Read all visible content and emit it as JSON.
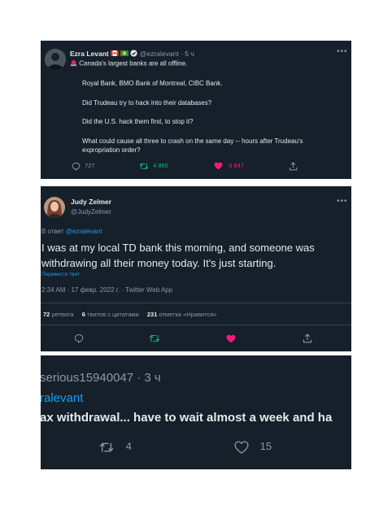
{
  "tweet1": {
    "author_name": "Ezra Levant",
    "handle_time": "@ezralevant · 5 ч",
    "line1": "Canada's largest banks are all offline.",
    "line2": "Royal Bank, BMO Bank of Montreal, CIBC Bank.",
    "line3": "Did Trudeau try to hack into their databases?",
    "line4": "Did the U.S. hack them first, to stop it?",
    "line5a": "What could cause all three to crash on the same day -- hours after Trudeau's",
    "line5b": "expropriation order?",
    "replies": "727",
    "retweets": "4 865",
    "likes": "9 847",
    "colors": {
      "retweet": "#00ba7c",
      "like": "#f91880"
    }
  },
  "tweet2": {
    "author_name": "Judy Zelmer",
    "handle": "@JudyZelmer",
    "reply_prefix": "В ответ",
    "reply_to": "@ezralevant",
    "text_line1": "I was at my local TD bank this morning, and someone was",
    "text_line2": "withdrawing all their money today. It's just starting.",
    "translate": "Перевести твит",
    "meta": "2:34 AM · 17 февр. 2022 г. · Twitter Web App",
    "retweet_count": "72",
    "retweet_label": "ретвита",
    "quote_count": "6",
    "quote_label": "твитов с цитатами",
    "like_count": "231",
    "like_label": "отметка «Нравится»"
  },
  "tweet3": {
    "handle_time": "serious15940047 · 3 ч",
    "mention": "ralevant",
    "text": "ax withdrawal... have to wait almost a week and ha",
    "retweets": "4",
    "likes": "15"
  }
}
